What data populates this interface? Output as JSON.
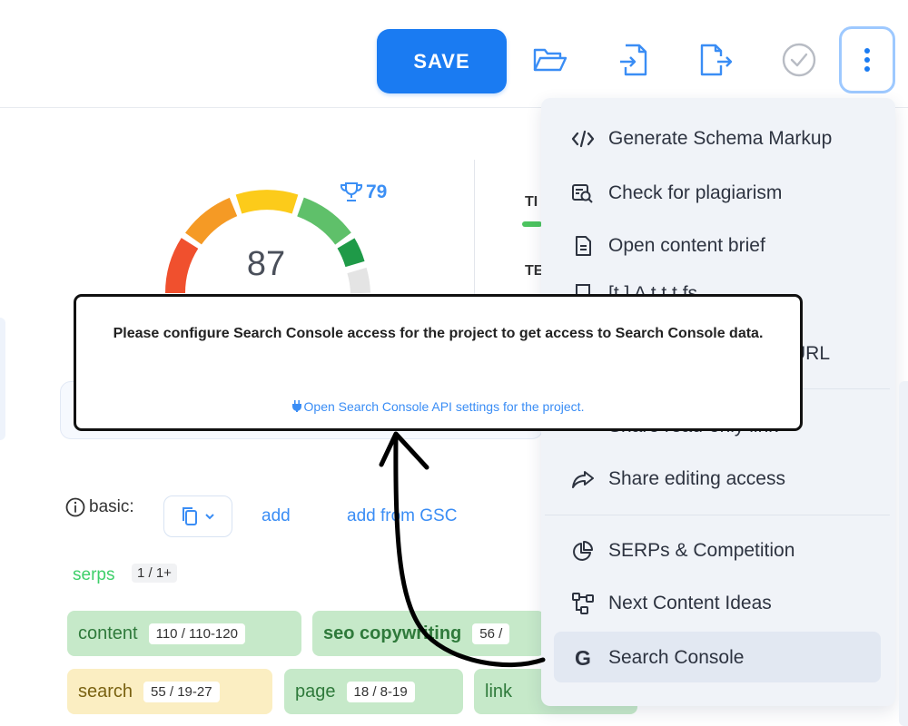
{
  "toolbar": {
    "save_label": "SAVE",
    "icons": [
      "folder-open-icon",
      "file-import-icon",
      "file-export-icon",
      "check-circle-icon",
      "more-vertical-icon"
    ]
  },
  "score": {
    "value": "87",
    "target_value": "79",
    "target_icon": "trophy-icon",
    "colors": [
      "#f0502e",
      "#f59a25",
      "#fccb1a",
      "#5fc06a",
      "#1f9a48",
      "#e4e4e4"
    ]
  },
  "side_peek": {
    "line1": "TI",
    "line2": "TE"
  },
  "tooltip": {
    "message": "Please configure Search Console access for the project to get access to Search Console data.",
    "link": "Open Search Console API settings for the project.",
    "link_icon": "plug-icon"
  },
  "keywords": {
    "basic_label": "basic:",
    "add_label": "add",
    "add_gsc_label": "add from GSC",
    "serps_label": "serps",
    "serps_count": "1 / 1+",
    "chips": [
      {
        "label": "content",
        "count": "110  /  110-120",
        "color": "green"
      },
      {
        "label": "seo copywriting",
        "count": "56  /",
        "color": "green"
      },
      {
        "label": "search",
        "count": "55  /  19-27",
        "color": "yellow"
      },
      {
        "label": "page",
        "count": "18  /  8-19",
        "color": "green"
      },
      {
        "label": "link",
        "count": "",
        "color": "green"
      }
    ]
  },
  "menu": {
    "items": [
      {
        "label": "Generate Schema Markup",
        "icon": "code-icon"
      },
      {
        "label": "Check for plagiarism",
        "icon": "plagiarism-icon"
      },
      {
        "label": "Open content brief",
        "icon": "document-icon"
      },
      {
        "label": "[t         ]  A   t   t   t   fs",
        "icon": "article-icon"
      },
      {
        "label": "URL",
        "icon": "link-icon"
      },
      {
        "label": "Share read-only link",
        "icon": "share-icon"
      },
      {
        "label": "Share editing access",
        "icon": "share-arrow-icon"
      },
      {
        "label": "SERPs & Competition",
        "icon": "pie-chart-icon"
      },
      {
        "label": "Next Content Ideas",
        "icon": "flow-icon"
      },
      {
        "label": "Search Console",
        "icon": "google-g-icon"
      }
    ],
    "accent": "#1a7bf2"
  }
}
